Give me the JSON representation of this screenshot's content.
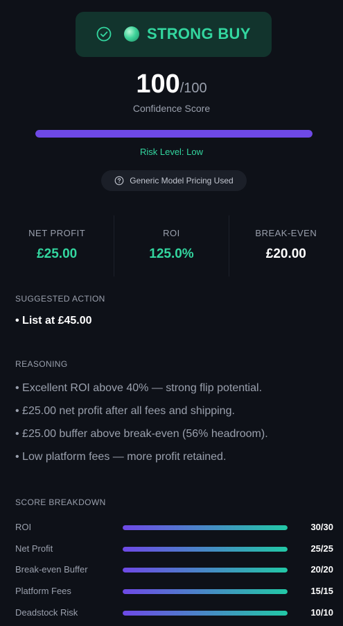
{
  "verdict": {
    "label": "STRONG BUY",
    "accent": "#33d69f",
    "icons": [
      "check-circle-icon",
      "status-orb-icon"
    ]
  },
  "score": {
    "value": "100",
    "max": "/100",
    "caption": "Confidence Score",
    "fraction": 1.0
  },
  "risk": {
    "text": "Risk Level: Low"
  },
  "pricing_note": {
    "text": "Generic Model Pricing Used",
    "icon": "question-circle-icon"
  },
  "stats": [
    {
      "label": "NET PROFIT",
      "value": "£25.00",
      "color": "#33d69f"
    },
    {
      "label": "ROI",
      "value": "125.0%",
      "color": "#33d69f"
    },
    {
      "label": "BREAK-EVEN",
      "value": "£20.00",
      "color": "#ffffff"
    }
  ],
  "suggested": {
    "title": "SUGGESTED ACTION",
    "action": "• List at £45.00"
  },
  "reasoning": {
    "title": "REASONING",
    "items": [
      "• Excellent ROI above 40% — strong flip potential.",
      "• £25.00 net profit after all fees and shipping.",
      "• £25.00 buffer above break-even (56% headroom).",
      "• Low platform fees — more profit retained."
    ]
  },
  "breakdown": {
    "title": "SCORE BREAKDOWN",
    "rows": [
      {
        "label": "ROI",
        "score": "30/30",
        "fraction": 1.0
      },
      {
        "label": "Net Profit",
        "score": "25/25",
        "fraction": 1.0
      },
      {
        "label": "Break-even Buffer",
        "score": "20/20",
        "fraction": 1.0
      },
      {
        "label": "Platform Fees",
        "score": "15/15",
        "fraction": 1.0
      },
      {
        "label": "Deadstock Risk",
        "score": "10/10",
        "fraction": 1.0
      }
    ]
  },
  "colors": {
    "background": "#0e1118",
    "accent_green": "#33d69f",
    "accent_purple": "#6e49e6",
    "muted_text": "#9aa0ad"
  }
}
